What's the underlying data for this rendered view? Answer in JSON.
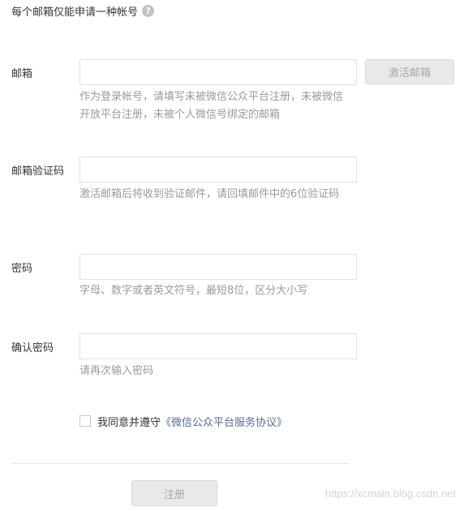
{
  "notice": {
    "text": "每个邮箱仅能申请一种帐号",
    "help_icon": "?"
  },
  "email": {
    "label": "邮箱",
    "value": "",
    "activate_button": "激活邮箱",
    "hint": "作为登录帐号，请填写未被微信公众平台注册，未被微信开放平台注册，未被个人微信号绑定的邮箱"
  },
  "verify_code": {
    "label": "邮箱验证码",
    "value": "",
    "hint": "激活邮箱后将收到验证邮件，请回填邮件中的6位验证码"
  },
  "password": {
    "label": "密码",
    "value": "",
    "hint": "字母、数字或者英文符号，最短8位，区分大小写"
  },
  "confirm_password": {
    "label": "确认密码",
    "value": "",
    "hint": "请再次输入密码"
  },
  "agreement": {
    "text": "我同意并遵守",
    "link": "《微信公众平台服务协议》",
    "checked": false
  },
  "register_button": "注册",
  "watermark": "https://xcmain.blog.csdn.net"
}
